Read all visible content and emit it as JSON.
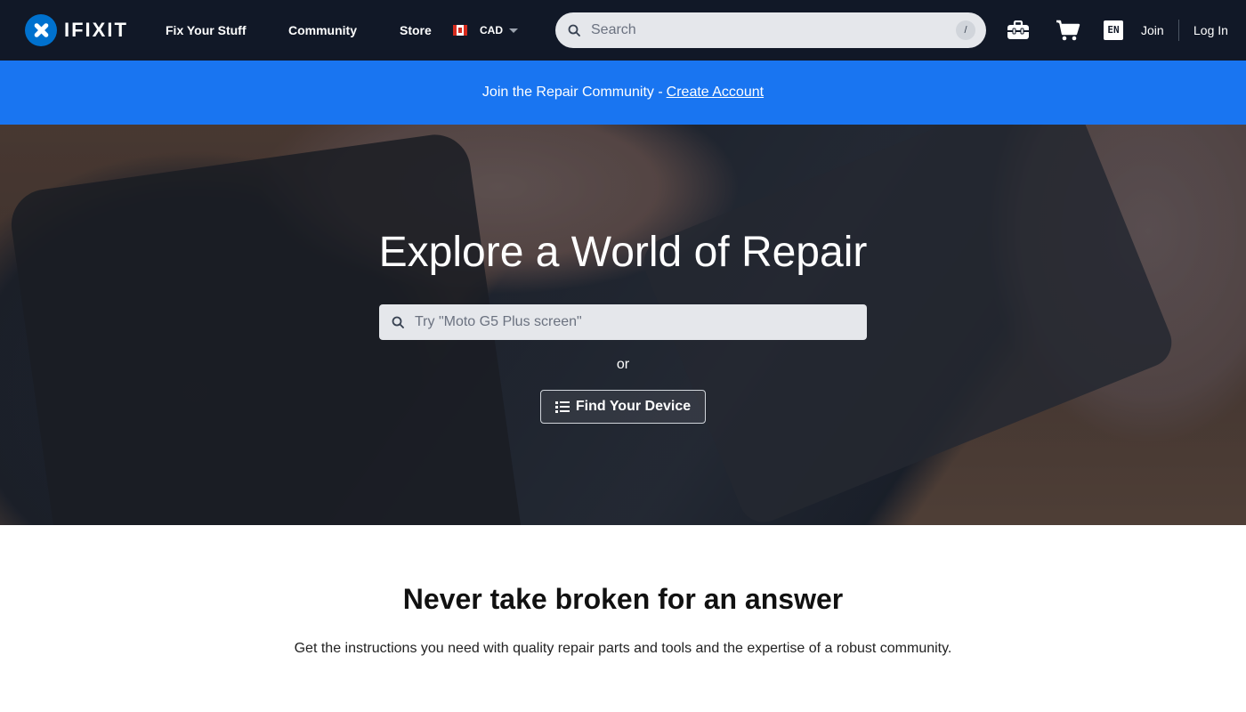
{
  "nav": {
    "logo_text": "IFIXIT",
    "links": {
      "fix": "Fix Your Stuff",
      "community": "Community",
      "store": "Store"
    },
    "currency": "CAD",
    "search_placeholder": "Search",
    "search_shortcut": "/",
    "language": "EN",
    "join": "Join",
    "login": "Log In"
  },
  "banner": {
    "text": "Join the Repair Community -",
    "link": "Create Account"
  },
  "hero": {
    "title": "Explore a World of Repair",
    "search_placeholder": "Try \"Moto G5 Plus screen\"",
    "or": "or",
    "find_button": "Find Your Device"
  },
  "content": {
    "headline": "Never take broken for an answer",
    "subline": "Get the instructions you need with quality repair parts and tools and the expertise of a robust community."
  },
  "colors": {
    "nav_bg": "#111827",
    "banner_bg": "#1975f1",
    "brand_blue": "#0071ce"
  }
}
